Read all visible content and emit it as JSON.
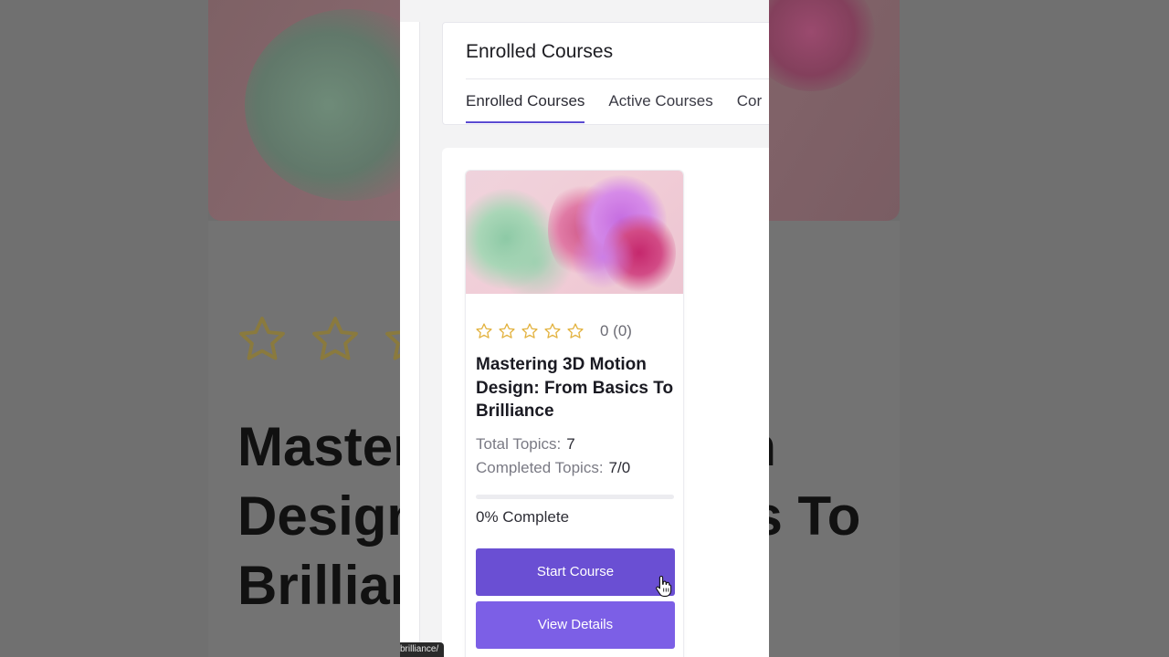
{
  "background": {
    "title": "Mastering 3D Motion Design: From Basics To Brilliance",
    "status_url": "brilliance/"
  },
  "header": {
    "title": "Enrolled Courses",
    "tabs": [
      {
        "label": "Enrolled Courses",
        "active": true
      },
      {
        "label": "Active Courses",
        "active": false
      },
      {
        "label": "Cor",
        "active": false
      }
    ]
  },
  "course": {
    "rating": 0,
    "rating_text": "0 (0)",
    "title": "Mastering 3D Motion Design: From Basics To Brilliance",
    "total_topics_label": "Total Topics:",
    "total_topics_value": "7",
    "completed_topics_label": "Completed Topics:",
    "completed_topics_value": "7/0",
    "progress_percent": 0,
    "progress_text": "0% Complete",
    "start_button": "Start Course",
    "details_button": "View Details"
  },
  "colors": {
    "accent": "#5b4bd1",
    "start_button": "#6a4fd3",
    "details_button": "#7c5fe6",
    "star": "#e3b341"
  },
  "icons": {
    "rating_star": "star-outline-icon",
    "cursor": "hand-pointer-icon"
  }
}
